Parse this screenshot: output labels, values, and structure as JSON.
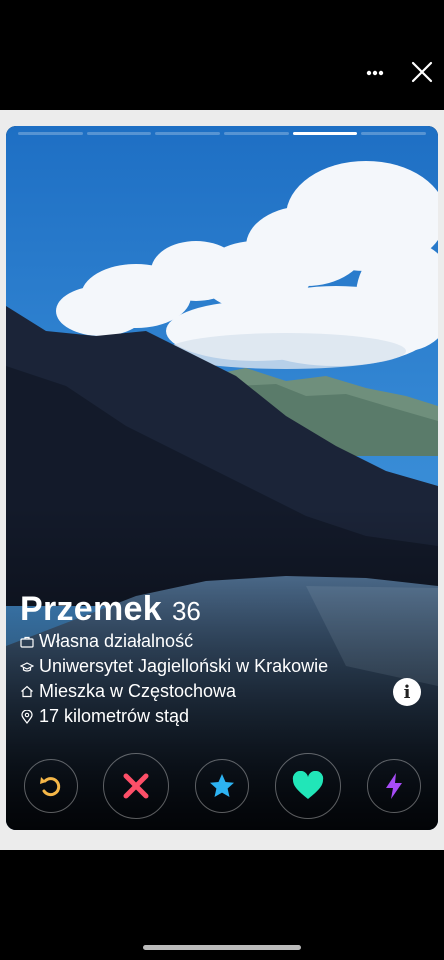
{
  "profile": {
    "name": "Przemek",
    "age": "36",
    "job": "Własna działalność",
    "school": "Uniwersytet Jagielloński w Krakowie",
    "city": "Mieszka w Częstochowa",
    "distance": "17 kilometrów stąd"
  },
  "info_button": {
    "label": "i"
  },
  "photo_progress": {
    "total_photos": 6,
    "current_photo": 5
  },
  "icons": {
    "more": "more-dots-icon",
    "close": "close-icon",
    "job": "briefcase-icon",
    "school": "graduation-cap-icon",
    "city": "home-icon",
    "distance": "location-pin-icon",
    "rewind": "rewind-icon",
    "nope": "x-icon",
    "super_like": "star-icon",
    "like": "heart-icon",
    "boost": "lightning-icon"
  },
  "colors": {
    "rewind": "#f5b748",
    "nope": "#fd4f68",
    "super_like": "#2db3f2",
    "like": "#21e6b8",
    "boost": "#a74cf6"
  }
}
